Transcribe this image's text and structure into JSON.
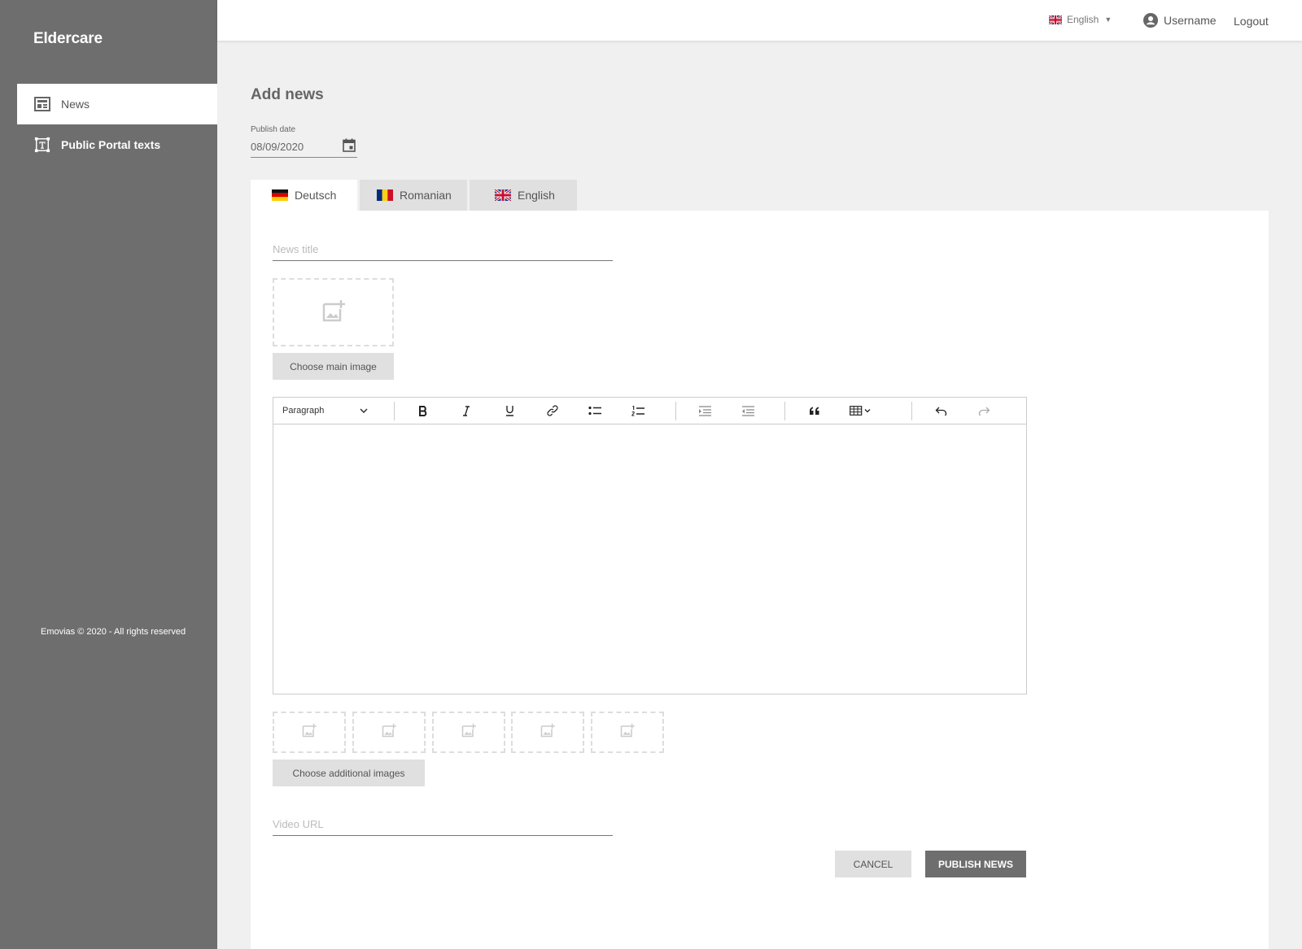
{
  "app": {
    "brand": "Eldercare"
  },
  "sidebar": {
    "items": [
      {
        "label": "News",
        "icon": "news-icon",
        "active": true
      },
      {
        "label": "Public Portal texts",
        "icon": "text-frame-icon",
        "active": false
      }
    ],
    "footer": "Emovias © 2020 - All rights reserved"
  },
  "topbar": {
    "language": "English",
    "username": "Username",
    "logout": "Logout"
  },
  "page": {
    "title": "Add news",
    "publish_date_label": "Publish date",
    "publish_date_value": "08/09/2020"
  },
  "tabs": [
    {
      "label": "Deutsch",
      "flag": "de-flag-icon",
      "active": true
    },
    {
      "label": "Romanian",
      "flag": "ro-flag-icon",
      "active": false
    },
    {
      "label": "English",
      "flag": "uk-flag-icon",
      "active": false
    }
  ],
  "form": {
    "news_title_placeholder": "News title",
    "choose_main_image": "Choose main image",
    "editor_block_format": "Paragraph",
    "choose_additional_images": "Choose additional images",
    "video_url_placeholder": "Video URL",
    "cancel": "CANCEL",
    "publish": "PUBLISH NEWS"
  },
  "colors": {
    "sidebar_bg": "#6e6e6e",
    "page_bg": "#f0f0f0",
    "primary_button": "#6e6e6e"
  }
}
